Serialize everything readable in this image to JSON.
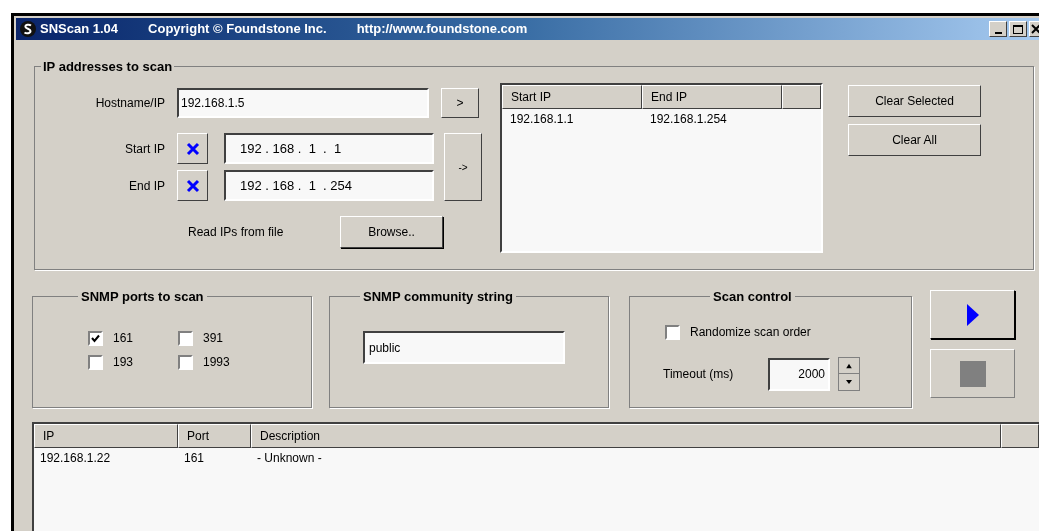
{
  "window": {
    "title_parts": [
      "SNScan 1.04",
      "Copyright © Foundstone Inc.",
      "http://www.foundstone.com"
    ]
  },
  "ip_group": {
    "title": "IP addresses to scan",
    "hostname": {
      "label": "Hostname/IP",
      "value": "192.168.1.5",
      "button": ">"
    },
    "start_ip": {
      "label": "Start IP",
      "value": "192 . 168 .  1  .  1"
    },
    "end_ip": {
      "label": "End IP",
      "value": "192 . 168 .  1  . 254"
    },
    "add_range_button": "->",
    "read_file": {
      "label": "Read IPs from file",
      "button": "Browse.."
    },
    "range_list": {
      "columns": [
        "Start IP",
        "End IP"
      ],
      "rows": [
        [
          "192.168.1.1",
          "192.168.1.254"
        ]
      ]
    },
    "buttons": [
      "Clear Selected",
      "Clear All"
    ]
  },
  "ports_group": {
    "title": "SNMP ports to scan",
    "ports": [
      {
        "label": "161",
        "checked": true
      },
      {
        "label": "391",
        "checked": false
      },
      {
        "label": "193",
        "checked": false
      },
      {
        "label": "1993",
        "checked": false
      }
    ]
  },
  "community_group": {
    "title": "SNMP community string",
    "value": "public"
  },
  "scan_control": {
    "title": "Scan control",
    "randomize": {
      "label": "Randomize scan order",
      "checked": false
    },
    "timeout": {
      "label": "Timeout (ms)",
      "value": "2000"
    }
  },
  "actions": [
    {
      "kind": "start",
      "disabled": false
    },
    {
      "kind": "stop",
      "disabled": true
    }
  ],
  "results": {
    "columns": [
      "IP",
      "Port",
      "Description"
    ],
    "rows": [
      [
        "192.168.1.22",
        "161",
        "- Unknown -"
      ]
    ]
  }
}
